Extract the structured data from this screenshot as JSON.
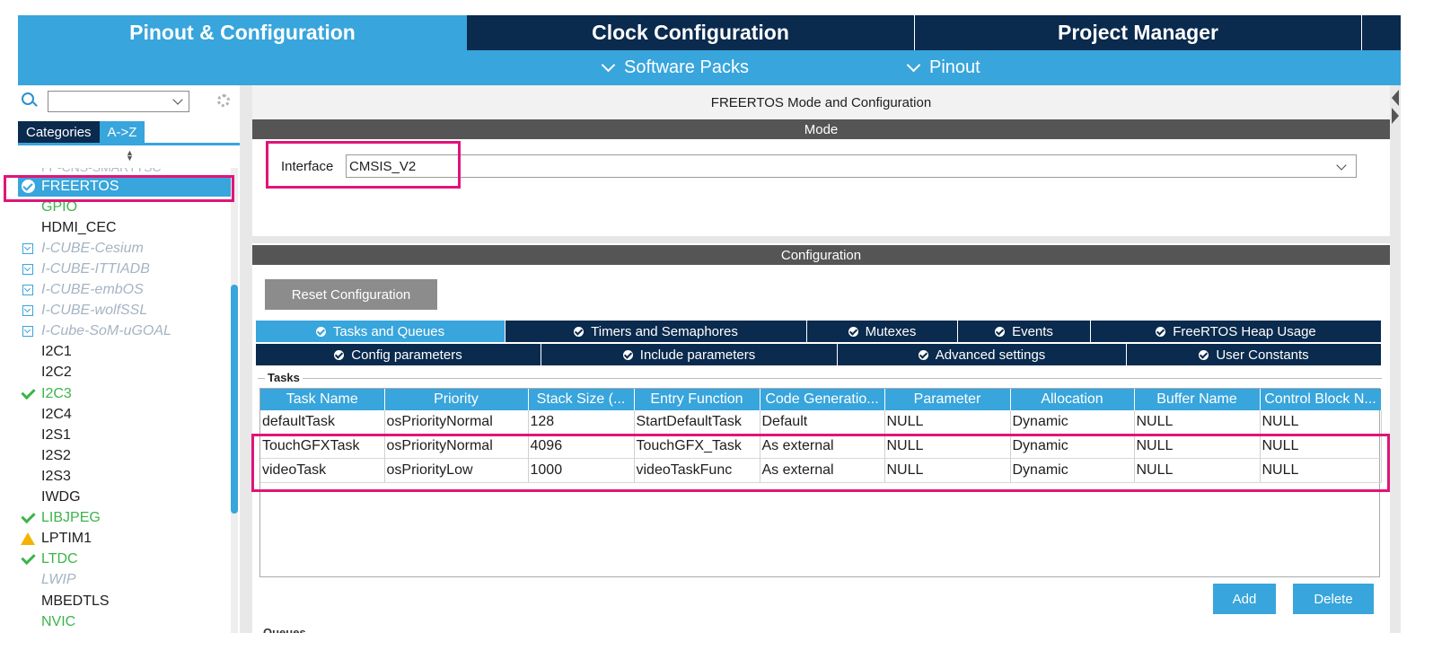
{
  "top_tabs": {
    "pinout": "Pinout & Configuration",
    "clock": "Clock Configuration",
    "project": "Project Manager"
  },
  "sub_menu": {
    "software_packs": "Software Packs",
    "pinout": "Pinout"
  },
  "sidebar": {
    "search_value": "",
    "tabs": {
      "categories": "Categories",
      "az": "A->Z"
    },
    "items": [
      {
        "label": "FREERTOS",
        "icon": "check-circle-icon",
        "style": "selected"
      },
      {
        "label": "GPIO",
        "icon": "",
        "style": "green"
      },
      {
        "label": "HDMI_CEC",
        "icon": "",
        "style": "normal"
      },
      {
        "label": "I-CUBE-Cesium",
        "icon": "download-icon",
        "style": "gray"
      },
      {
        "label": "I-CUBE-ITTIADB",
        "icon": "download-icon",
        "style": "gray"
      },
      {
        "label": "I-CUBE-embOS",
        "icon": "download-icon",
        "style": "gray"
      },
      {
        "label": "I-CUBE-wolfSSL",
        "icon": "download-icon",
        "style": "gray"
      },
      {
        "label": "I-Cube-SoM-uGOAL",
        "icon": "download-icon",
        "style": "gray"
      },
      {
        "label": "I2C1",
        "icon": "",
        "style": "normal"
      },
      {
        "label": "I2C2",
        "icon": "",
        "style": "normal"
      },
      {
        "label": "I2C3",
        "icon": "check-icon",
        "style": "green"
      },
      {
        "label": "I2C4",
        "icon": "",
        "style": "normal"
      },
      {
        "label": "I2S1",
        "icon": "",
        "style": "normal"
      },
      {
        "label": "I2S2",
        "icon": "",
        "style": "normal"
      },
      {
        "label": "I2S3",
        "icon": "",
        "style": "normal"
      },
      {
        "label": "IWDG",
        "icon": "",
        "style": "normal"
      },
      {
        "label": "LIBJPEG",
        "icon": "check-icon",
        "style": "green"
      },
      {
        "label": "LPTIM1",
        "icon": "warning-icon",
        "style": "normal"
      },
      {
        "label": "LTDC",
        "icon": "check-icon",
        "style": "green"
      },
      {
        "label": "LWIP",
        "icon": "",
        "style": "gray"
      },
      {
        "label": "MBEDTLS",
        "icon": "",
        "style": "normal"
      },
      {
        "label": "NVIC",
        "icon": "",
        "style": "green"
      }
    ]
  },
  "main": {
    "title": "FREERTOS Mode and Configuration",
    "mode_header": "Mode",
    "interface_label": "Interface",
    "interface_value": "CMSIS_V2",
    "config_header": "Configuration",
    "reset_button": "Reset Configuration",
    "tabs_row1": [
      "Tasks and Queues",
      "Timers and Semaphores",
      "Mutexes",
      "Events",
      "FreeRTOS Heap Usage"
    ],
    "tabs_row2": [
      "Config parameters",
      "Include parameters",
      "Advanced settings",
      "User Constants"
    ],
    "tasks_label": "Tasks",
    "columns": [
      "Task Name",
      "Priority",
      "Stack Size (...",
      "Entry Function",
      "Code Generatio...",
      "Parameter",
      "Allocation",
      "Buffer Name",
      "Control Block N..."
    ],
    "rows": [
      [
        "defaultTask",
        "osPriorityNormal",
        "128",
        "StartDefaultTask",
        "Default",
        "NULL",
        "Dynamic",
        "NULL",
        "NULL"
      ],
      [
        "TouchGFXTask",
        "osPriorityNormal",
        "4096",
        "TouchGFX_Task",
        "As external",
        "NULL",
        "Dynamic",
        "NULL",
        "NULL"
      ],
      [
        "videoTask",
        "osPriorityLow",
        "1000",
        "videoTaskFunc",
        "As external",
        "NULL",
        "Dynamic",
        "NULL",
        "NULL"
      ]
    ],
    "add_button": "Add",
    "delete_button": "Delete",
    "queues_label": "Queues"
  },
  "colors": {
    "accent": "#38a5dc",
    "navy": "#0a2a4e",
    "highlight": "#e0147a",
    "ok_green": "#3cb44a"
  }
}
